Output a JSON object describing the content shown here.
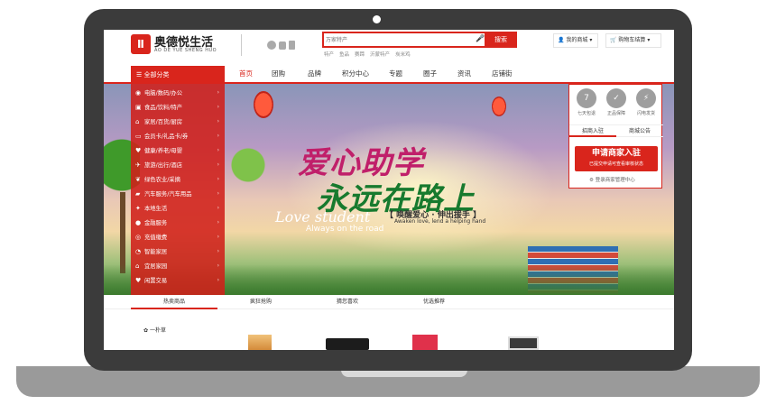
{
  "brand": {
    "logo_mark": "Ⅱ",
    "name": "奥德悦生活",
    "sub": "AO DE YUE SHENG HUO"
  },
  "search": {
    "placeholder": "万家特产",
    "button": "搜索",
    "hot_words": [
      "特产",
      "鱼品",
      "赛蹄",
      "沂蒙特产",
      "炭米鸡"
    ]
  },
  "header": {
    "my_store": "我的商城",
    "cart": "购物车结算"
  },
  "nav": {
    "all_categories": "全部分类",
    "items": [
      "首页",
      "团购",
      "品牌",
      "积分中心",
      "专题",
      "圈子",
      "资讯",
      "店铺街"
    ]
  },
  "sidebar": {
    "items": [
      "电脑/数码/办公",
      "食品/饮料/特产",
      "家居/百货/厨房",
      "会员卡/礼品卡/券",
      "健康/养老/母婴",
      "旅游/出行/酒店",
      "绿色农业/采摘",
      "汽车服务/汽车用品",
      "本地生活",
      "金融服务",
      "充值缴费",
      "智能家居",
      "宜居家园",
      "闲置交易"
    ]
  },
  "banner": {
    "title_line1": "爱心助学",
    "title_line2": "永远在路上",
    "script": "Love student",
    "sub_en": "Always on the road",
    "slogan": "【 唤醒爱心 · 伸出援手 】",
    "slogan_en": "Awaken love, lend a helping hand"
  },
  "panel": {
    "services": [
      "七天包退",
      "正品保障",
      "闪电发货"
    ],
    "tabs": [
      "招商入驻",
      "商城公告"
    ],
    "apply_title": "申请商家入驻",
    "apply_sub": "已提交申请可查看审核状态",
    "manage_link": "登录商家管理中心"
  },
  "bottom_tabs": [
    "热卖商品",
    "疯狂抢购",
    "猜您喜欢",
    "优选推荐"
  ],
  "products": {
    "brand_text": "一朴草"
  },
  "colors": {
    "accent": "#d9251c",
    "bezel": "#3b3b3b"
  }
}
